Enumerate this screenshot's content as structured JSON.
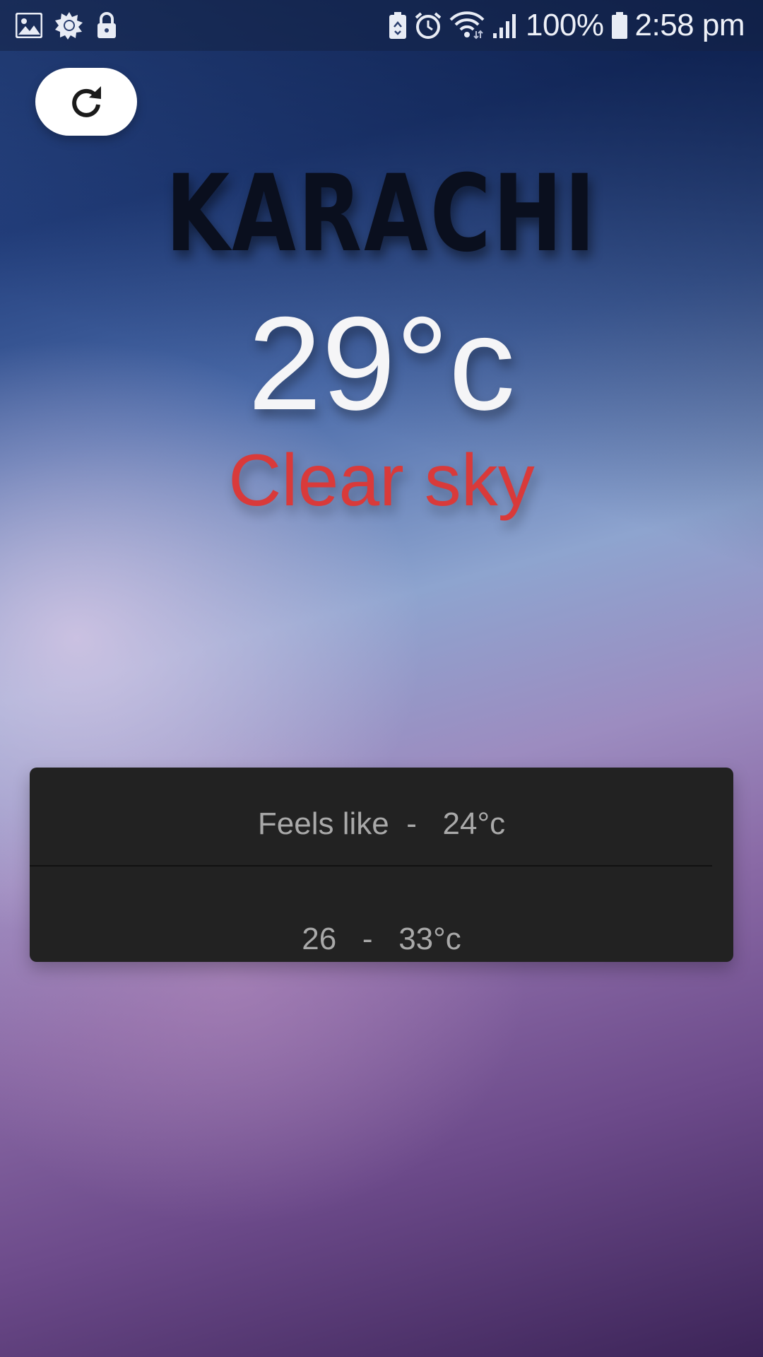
{
  "status_bar": {
    "left_icons": [
      "image-icon",
      "brightness-icon",
      "lock-icon"
    ],
    "right_icons": [
      "battery-saver-icon",
      "alarm-icon",
      "wifi-icon",
      "signal-icon",
      "battery-icon"
    ],
    "battery": "100%",
    "time": "2:58 pm"
  },
  "toolbar": {
    "refresh_icon": "refresh-icon"
  },
  "weather": {
    "city": "KARACHI",
    "temperature": "29°c",
    "condition": "Clear sky"
  },
  "details": {
    "feels_like": "Feels like  -   24°c",
    "range": "26   -   33°c"
  },
  "colors": {
    "condition_text": "#d93a3a",
    "card_background": "#222222",
    "card_text": "#a9a9a9"
  }
}
